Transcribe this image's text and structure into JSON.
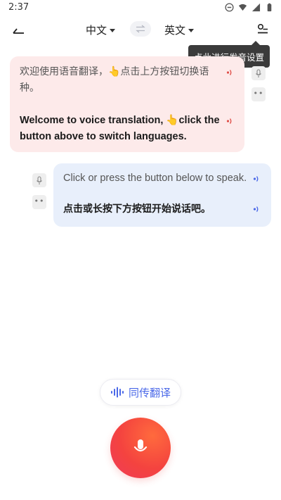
{
  "status": {
    "time": "2:37"
  },
  "header": {
    "source_lang": "中文",
    "target_lang": "英文"
  },
  "tooltip": {
    "text": "点此进行发音设置"
  },
  "messages": [
    {
      "side": "left",
      "source_text": "欢迎使用语音翻译，👆点击上方按钮切换语种。",
      "translated_text": "Welcome to voice translation, 👆click the button above to switch languages."
    },
    {
      "side": "right",
      "source_text": "Click or press the button below to speak.",
      "translated_text": "点击或长按下方按钮开始说话吧。"
    }
  ],
  "footer": {
    "simultaneous_label": "同传翻译"
  },
  "colors": {
    "left_bubble": "#fdeaea",
    "right_bubble": "#e8effb",
    "accent_blue": "#4a68e8",
    "mic_red": "#f4433f"
  },
  "icons": {
    "status": [
      "dnd-icon",
      "wifi-icon",
      "signal-icon",
      "battery-icon"
    ],
    "back": "back-arrow-icon",
    "swap": "swap-icon",
    "settings": "voice-settings-icon",
    "speaker": "speaker-icon",
    "mic": "microphone-icon",
    "waveform": "waveform-icon"
  }
}
